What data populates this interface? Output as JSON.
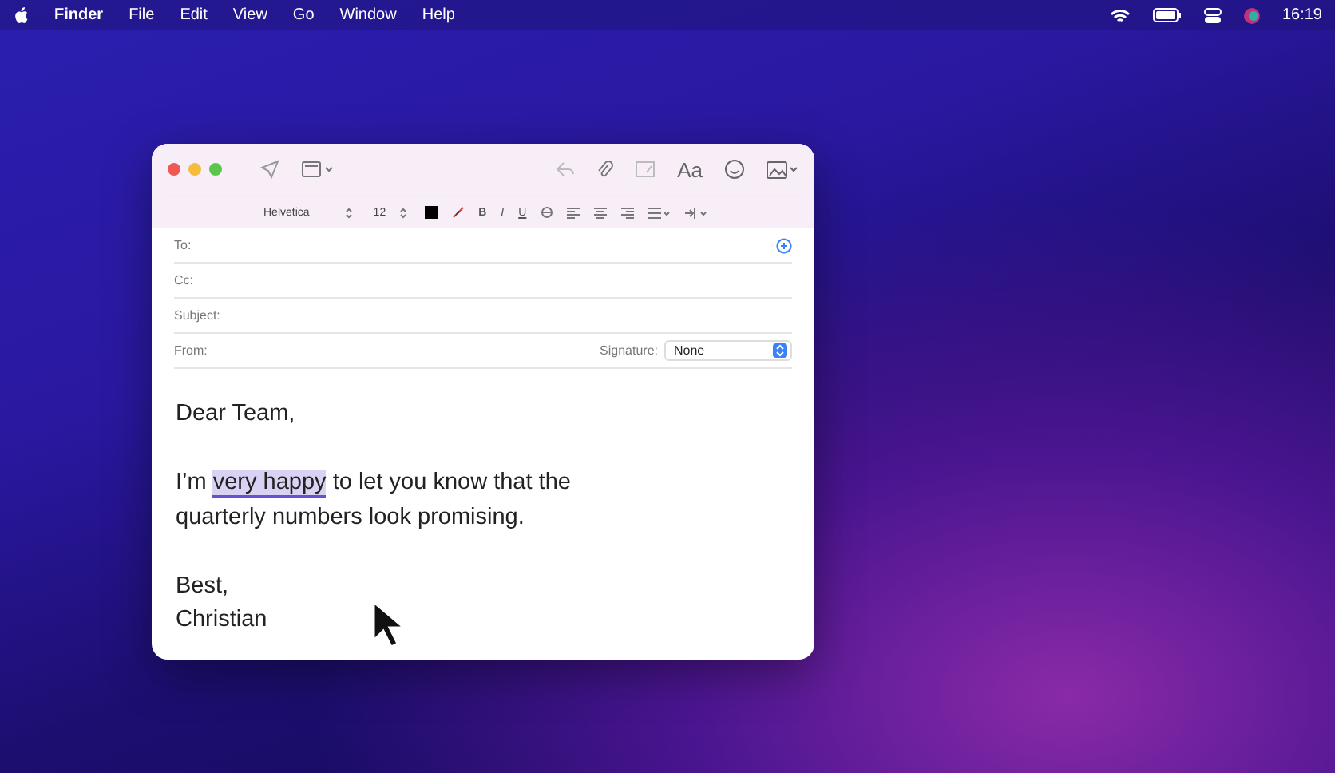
{
  "menu_bar": {
    "app": "Finder",
    "items": [
      "File",
      "Edit",
      "View",
      "Go",
      "Window",
      "Help"
    ],
    "clock": "16:19"
  },
  "compose_window": {
    "toolbar": {
      "font_label": "Aa"
    },
    "format_bar": {
      "font": "Helvetica",
      "size": "12",
      "styles": [
        "B",
        "I",
        "U"
      ]
    },
    "fields": [
      {
        "kind": "to",
        "label": "To:"
      },
      {
        "kind": "plain",
        "label": "Cc:"
      },
      {
        "kind": "plain",
        "label": "Subject:"
      },
      {
        "kind": "from",
        "label": "From:",
        "signature_label": "Signature:",
        "signature_value": "None"
      }
    ],
    "body": [
      [
        [
          {
            "text": "Dear Team,",
            "selected": false
          }
        ]
      ],
      [
        [
          {
            "text": "I’m ",
            "selected": false
          },
          {
            "text": "very happy",
            "selected": true
          },
          {
            "text": " to let you know that the",
            "selected": false
          }
        ],
        [
          {
            "text": "quarterly numbers look promising.",
            "selected": false
          }
        ]
      ],
      [
        [
          {
            "text": "Best,",
            "selected": false
          }
        ],
        [
          {
            "text": "Christian",
            "selected": false
          }
        ]
      ]
    ]
  }
}
